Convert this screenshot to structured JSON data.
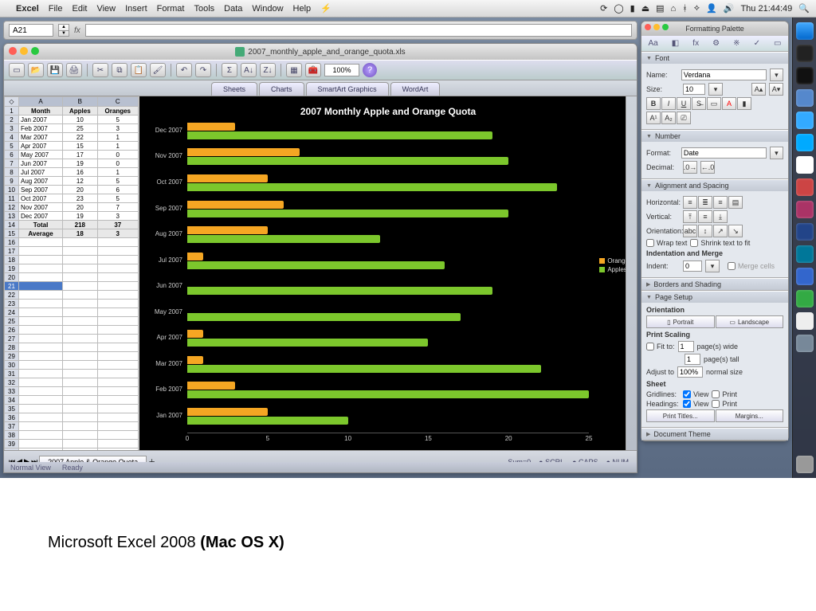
{
  "menubar": {
    "app": "Excel",
    "items": [
      "File",
      "Edit",
      "View",
      "Insert",
      "Format",
      "Tools",
      "Data",
      "Window",
      "Help"
    ],
    "clock": "Thu 21:44:49"
  },
  "formula_bar": {
    "cell_ref": "A21",
    "fx_label": "fx"
  },
  "workbook": {
    "title": "2007_monthly_apple_and_orange_quota.xls",
    "zoom": "100%",
    "ribbon_tabs": [
      "Sheets",
      "Charts",
      "SmartArt Graphics",
      "WordArt"
    ],
    "sheet_tabs": [
      "2007 Apple & Orange Quota"
    ],
    "status": {
      "view": "Normal View",
      "ready": "Ready",
      "sum": "Sum=0",
      "ind": [
        "SCRL",
        "CAPS",
        "NUM"
      ]
    },
    "columns": [
      "",
      "A",
      "B",
      "C"
    ],
    "headers": [
      "Month",
      "Apples",
      "Oranges"
    ],
    "rows": [
      [
        "Jan 2007",
        "10",
        "5"
      ],
      [
        "Feb 2007",
        "25",
        "3"
      ],
      [
        "Mar 2007",
        "22",
        "1"
      ],
      [
        "Apr 2007",
        "15",
        "1"
      ],
      [
        "May 2007",
        "17",
        "0"
      ],
      [
        "Jun 2007",
        "19",
        "0"
      ],
      [
        "Jul 2007",
        "16",
        "1"
      ],
      [
        "Aug 2007",
        "12",
        "5"
      ],
      [
        "Sep 2007",
        "20",
        "6"
      ],
      [
        "Oct 2007",
        "23",
        "5"
      ],
      [
        "Nov 2007",
        "20",
        "7"
      ],
      [
        "Dec 2007",
        "19",
        "3"
      ]
    ],
    "totals_label": "Total",
    "totals": [
      "218",
      "37"
    ],
    "avg_label": "Average",
    "avg": [
      "18",
      "3"
    ]
  },
  "chart_data": {
    "type": "bar",
    "title": "2007 Monthly Apple and Orange Quota",
    "categories": [
      "Jan 2007",
      "Feb 2007",
      "Mar 2007",
      "Apr 2007",
      "May 2007",
      "Jun 2007",
      "Jul 2007",
      "Aug 2007",
      "Sep 2007",
      "Oct 2007",
      "Nov 2007",
      "Dec 2007"
    ],
    "series": [
      {
        "name": "Oranges",
        "color": "#f5a623",
        "values": [
          5,
          3,
          1,
          1,
          0,
          0,
          1,
          5,
          6,
          5,
          7,
          3
        ]
      },
      {
        "name": "Apples",
        "color": "#7cc72c",
        "values": [
          10,
          25,
          22,
          15,
          17,
          19,
          16,
          12,
          20,
          23,
          20,
          19
        ]
      }
    ],
    "xlim": [
      0,
      25
    ],
    "xticks": [
      0,
      5,
      10,
      15,
      20,
      25
    ],
    "legend": [
      "Oranges",
      "Apples"
    ]
  },
  "palette": {
    "title": "Formatting Palette",
    "font": {
      "h": "Font",
      "name_lbl": "Name:",
      "name": "Verdana",
      "size_lbl": "Size:",
      "size": "10"
    },
    "number": {
      "h": "Number",
      "format_lbl": "Format:",
      "format": "Date",
      "decimal_lbl": "Decimal:"
    },
    "align": {
      "h": "Alignment and Spacing",
      "horiz": "Horizontal:",
      "vert": "Vertical:",
      "orient": "Orientation:",
      "wrap": "Wrap text",
      "shrink": "Shrink text to fit",
      "indent_h": "Indentation and Merge",
      "indent_lbl": "Indent:",
      "indent": "0",
      "merge": "Merge cells"
    },
    "borders": {
      "h": "Borders and Shading"
    },
    "page": {
      "h": "Page Setup",
      "orient_h": "Orientation",
      "portrait": "Portrait",
      "landscape": "Landscape",
      "scale_h": "Print Scaling",
      "fit": "Fit to:",
      "wide": "page(s) wide",
      "tall": "page(s) tall",
      "one": "1",
      "adjust": "Adjust to",
      "adjust_v": "100%",
      "normal": "normal size",
      "sheet_h": "Sheet",
      "gridlines": "Gridlines:",
      "headings": "Headings:",
      "view": "View",
      "print": "Print",
      "titles": "Print Titles...",
      "margins": "Margins..."
    },
    "theme": {
      "h": "Document Theme"
    }
  },
  "caption": {
    "p1": "Microsoft Excel 2008 ",
    "p2": "(Mac OS X)"
  }
}
